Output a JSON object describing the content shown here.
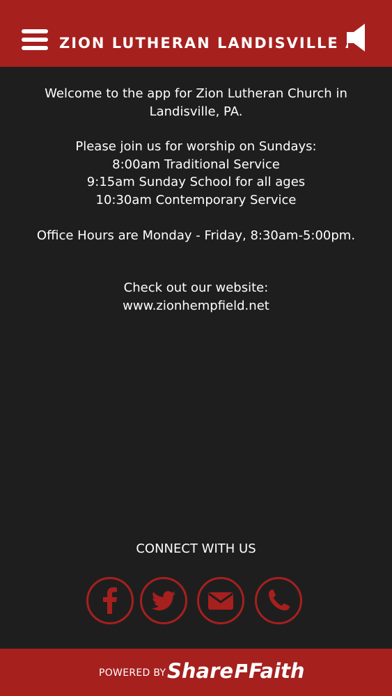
{
  "header": {
    "title": "ZION LUTHERAN LANDISVILLE A",
    "menu_icon": "hamburger-menu-icon",
    "audio_icon": "speaker-icon"
  },
  "content": {
    "welcome_line1": "Welcome to the app for Zion Lutheran Church in",
    "welcome_line2": "Landisville, PA.",
    "worship_intro": "Please join us for worship on Sundays:",
    "service_1": "8:00am Traditional Service",
    "service_2": "9:15am Sunday School for all ages",
    "service_3": "10:30am Contemporary Service",
    "office_hours": "Office Hours are Monday - Friday, 8:30am-5:00pm.",
    "website_intro": "Check out our website:",
    "website_url": "www.zionhempfield.net"
  },
  "connect": {
    "title": "CONNECT WITH US",
    "icons": [
      "facebook-icon",
      "twitter-icon",
      "email-icon",
      "phone-icon"
    ]
  },
  "footer": {
    "powered_by": "POWERED BY",
    "brand_part1": "Share",
    "brand_part2": "Faith"
  },
  "colors": {
    "brand_red": "#a6201e",
    "background": "#1f1e1f",
    "text": "#ffffff"
  }
}
